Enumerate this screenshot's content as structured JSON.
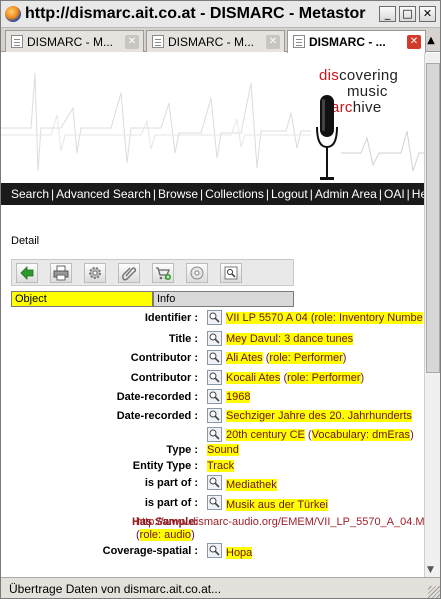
{
  "window": {
    "title": "http://dismarc.ait.co.at - DISMARC - Metastor"
  },
  "tabs": [
    {
      "label": "DISMARC - M..."
    },
    {
      "label": "DISMARC - M..."
    },
    {
      "label": "DISMARC - ..."
    }
  ],
  "brand": {
    "line1_pre": "",
    "line1_hl": "dis",
    "line1_post": "covering",
    "line2": "music",
    "line3_hl": "arc",
    "line3_post": "hive"
  },
  "nav": {
    "search": "Search",
    "advanced": "Advanced Search",
    "browse": "Browse",
    "collections": "Collections",
    "logout": "Logout",
    "admin": "Admin Area",
    "oai": "OAI",
    "help": "Help",
    "separator": "|"
  },
  "detail": {
    "heading": "Detail"
  },
  "view_tabs": {
    "object": "Object",
    "info": "Info"
  },
  "metadata": {
    "identifier": {
      "label": "Identifier :",
      "value": "VII LP 5570 A 04",
      "role_open": " (",
      "role_key": "role:",
      "role_val": " Inventory Numbe"
    },
    "title": {
      "label": "Title :",
      "value": "Mey Davul: 3 dance tunes"
    },
    "contributor1": {
      "label": "Contributor :",
      "value": "Ali Ates",
      "role_open": " (",
      "role_key": "role:",
      "role_val": " Performer",
      "role_close": ")"
    },
    "contributor2": {
      "label": "Contributor :",
      "value": "Kocali Ates",
      "role_open": " (",
      "role_key": "role:",
      "role_val": " Performer",
      "role_close": ")"
    },
    "date1": {
      "label": "Date-recorded :",
      "value": "1968"
    },
    "date2": {
      "label": "Date-recorded :",
      "value": "Sechziger Jahre des 20. Jahrhunderts"
    },
    "date2b": {
      "value": "20th century CE",
      "vocab_open": " (",
      "vocab_key": "Vocabulary:",
      "vocab_val": " dmEras",
      "vocab_close": ")"
    },
    "type": {
      "label": "Type :",
      "value": "Sound"
    },
    "entity_type": {
      "label": "Entity Type :",
      "value": "Track"
    },
    "part1": {
      "label": "is part of :",
      "value": "Mediathek"
    },
    "part2": {
      "label": "is part of :",
      "value": "Musik aus der Türkei"
    },
    "sample": {
      "label": "Has Sample:",
      "url": "http://www.dismarc-audio.org/EMEM/VII_LP_5570_A_04.M",
      "role_open": "(",
      "role_key": "role:",
      "role_val": " audio",
      "role_close": ")"
    },
    "coverage": {
      "label": "Coverage-spatial :",
      "value": "Hopa"
    }
  },
  "status": {
    "text": "Übertrage Daten von dismarc.ait.co.at..."
  },
  "colors": {
    "highlight": "#ffff00",
    "navbar": "#1a1a1a",
    "accent_red": "#c8161d"
  }
}
